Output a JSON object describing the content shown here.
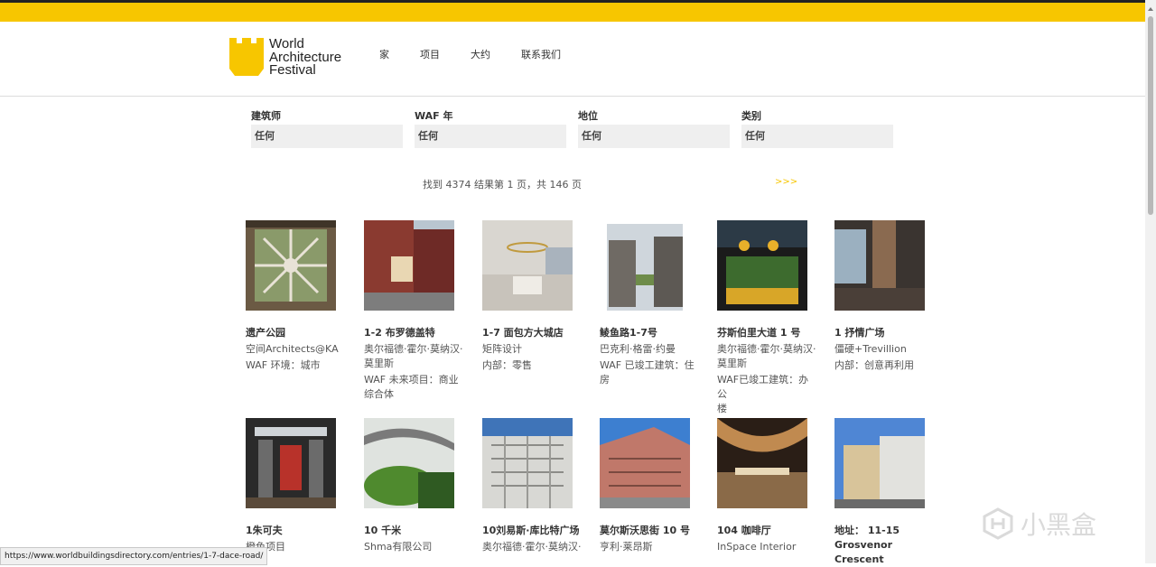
{
  "logo": {
    "line1": "World",
    "line2": "Architecture",
    "line3": "Festival"
  },
  "nav": [
    "家",
    "项目",
    "大约",
    "联系我们"
  ],
  "filters": [
    {
      "label": "建筑师",
      "value": "任何"
    },
    {
      "label": "WAF 年",
      "value": "任何"
    },
    {
      "label": "地位",
      "value": "任何"
    },
    {
      "label": "类别",
      "value": "任何"
    }
  ],
  "results_text": "找到 4374 结果第 1 页，共 146 页",
  "next_link": ">>>",
  "cards_row1": [
    {
      "title": "遗产公园",
      "lines": [
        "空间Architects@KA",
        "WAF 环境：城市"
      ]
    },
    {
      "title": "1-2 布罗德盖特",
      "lines": [
        "奥尔福德·霍尔·莫纳汉·",
        "莫里斯",
        "WAF 未来项目：商业",
        "综合体"
      ]
    },
    {
      "title": "1-7 面包方大城店",
      "lines": [
        "矩阵设计",
        "内部：零售"
      ]
    },
    {
      "title": "鲮鱼路1-7号",
      "lines": [
        "巴克利·格雷·约曼",
        "WAF 已竣工建筑：住",
        "房"
      ]
    },
    {
      "title": "芬斯伯里大道 1 号",
      "lines": [
        "奥尔福德·霍尔·莫纳汉·",
        "莫里斯",
        "WAF已竣工建筑：办公",
        "楼"
      ]
    },
    {
      "title": "1 抒情广场",
      "lines": [
        "僵硬+Trevillion",
        "内部：创意再利用"
      ]
    }
  ],
  "cards_row2": [
    {
      "title": "1朱可夫",
      "lines": [
        "橙色项目"
      ]
    },
    {
      "title": "10 千米",
      "lines": [
        "Shma有限公司"
      ]
    },
    {
      "title": "10刘易斯·库比特广场",
      "lines": [
        "奥尔福德·霍尔·莫纳汉·"
      ]
    },
    {
      "title": "莫尔斯沃思街 10 号",
      "lines": [
        "亨利·莱昂斯"
      ]
    },
    {
      "title": "104 咖啡厅",
      "lines": [
        "InSpace Interior"
      ]
    },
    {
      "title": "地址： 11-15",
      "title2": "Grosvenor Crescent",
      "lines": []
    }
  ],
  "status_url": "https://www.worldbuildingsdirectory.com/entries/1-7-dace-road/",
  "watermark": "小黑盒",
  "colors": {
    "accent": "#f7c600",
    "topbar_border": "#222222"
  }
}
